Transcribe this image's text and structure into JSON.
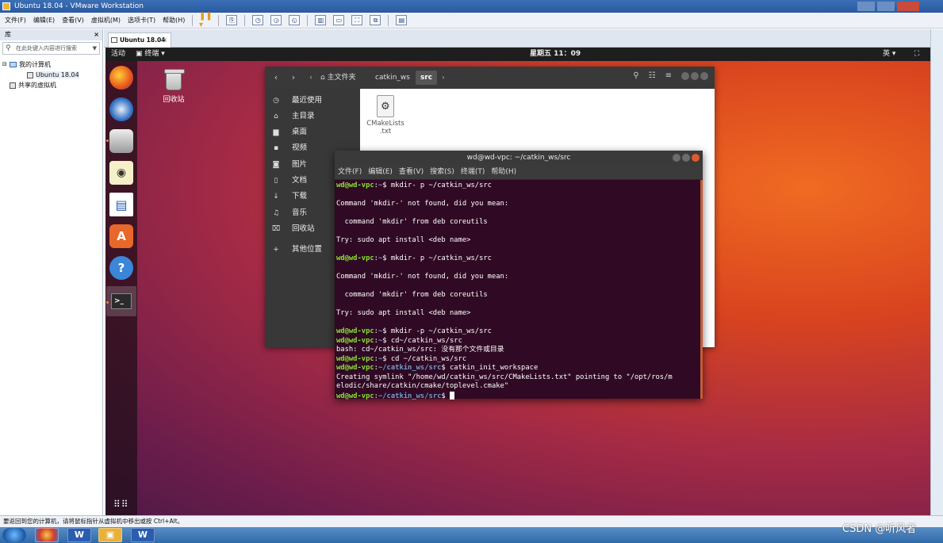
{
  "vmware": {
    "title": "Ubuntu 18.04 - VMware Workstation",
    "menu": [
      "文件(F)",
      "编辑(E)",
      "查看(V)",
      "虚拟机(M)",
      "选项卡(T)",
      "帮助(H)"
    ],
    "library": {
      "header": "库",
      "search_placeholder": "在此处键入内容进行搜索",
      "tree": {
        "my_computer": "我的计算机",
        "vm": "Ubuntu 18.04",
        "shared": "共享的虚拟机"
      }
    },
    "tab_label": "Ubuntu 18.04",
    "status": "要返回到您的计算机，请将鼠标指针从虚拟机中移出或按 Ctrl+Alt。"
  },
  "ubuntu": {
    "topbar": {
      "activities": "活动",
      "app_menu": "终端 ▾",
      "clock": "星期五 11：09",
      "ime": "英 ▾",
      "net": "⛶"
    },
    "desktop_trash_label": "回收站",
    "files": {
      "breadcrumbs": [
        "主文件夹",
        "catkin_ws",
        "src"
      ],
      "sidebar": [
        "最近使用",
        "主目录",
        "桌面",
        "视频",
        "图片",
        "文档",
        "下载",
        "音乐",
        "回收站",
        "其他位置"
      ],
      "file_name": "CMakeLists\n.txt"
    },
    "terminal": {
      "title": "wd@wd-vpc: ~/catkin_ws/src",
      "menu": [
        "文件(F)",
        "编辑(E)",
        "查看(V)",
        "搜索(S)",
        "终端(T)",
        "帮助(H)"
      ],
      "prompt_user": "wd@wd-vpc",
      "lines": [
        {
          "kind": "cmd",
          "path": "~",
          "text": "$ mkdir- p ~/catkin_ws/src"
        },
        {
          "kind": "blank"
        },
        {
          "kind": "out",
          "text": "Command 'mkdir-' not found, did you mean:"
        },
        {
          "kind": "blank"
        },
        {
          "kind": "out",
          "text": "  command 'mkdir' from deb coreutils"
        },
        {
          "kind": "blank"
        },
        {
          "kind": "out",
          "text": "Try: sudo apt install <deb name>"
        },
        {
          "kind": "blank"
        },
        {
          "kind": "cmd",
          "path": "~",
          "text": "$ mkdir- p ~/catkin_ws/src"
        },
        {
          "kind": "blank"
        },
        {
          "kind": "out",
          "text": "Command 'mkdir-' not found, did you mean:"
        },
        {
          "kind": "blank"
        },
        {
          "kind": "out",
          "text": "  command 'mkdir' from deb coreutils"
        },
        {
          "kind": "blank"
        },
        {
          "kind": "out",
          "text": "Try: sudo apt install <deb name>"
        },
        {
          "kind": "blank"
        },
        {
          "kind": "cmd",
          "path": "~",
          "text": "$ mkdir -p ~/catkin_ws/src"
        },
        {
          "kind": "cmd",
          "path": "~",
          "text": "$ cd~/catkin_ws/src"
        },
        {
          "kind": "out",
          "text": "bash: cd~/catkin_ws/src: 没有那个文件或目录"
        },
        {
          "kind": "cmd",
          "path": "~",
          "text": "$ cd ~/catkin_ws/src"
        },
        {
          "kind": "cmd",
          "path": "~/catkin_ws/src",
          "text": "$ catkin_init_workspace"
        },
        {
          "kind": "out",
          "text": "Creating symlink \"/home/wd/catkin_ws/src/CMakeLists.txt\" pointing to \"/opt/ros/m"
        },
        {
          "kind": "out",
          "text": "elodic/share/catkin/cmake/toplevel.cmake\""
        },
        {
          "kind": "cmd",
          "path": "~/catkin_ws/src",
          "text": "$ ",
          "cursor": true
        }
      ]
    }
  },
  "watermark": "CSDN @听风者"
}
